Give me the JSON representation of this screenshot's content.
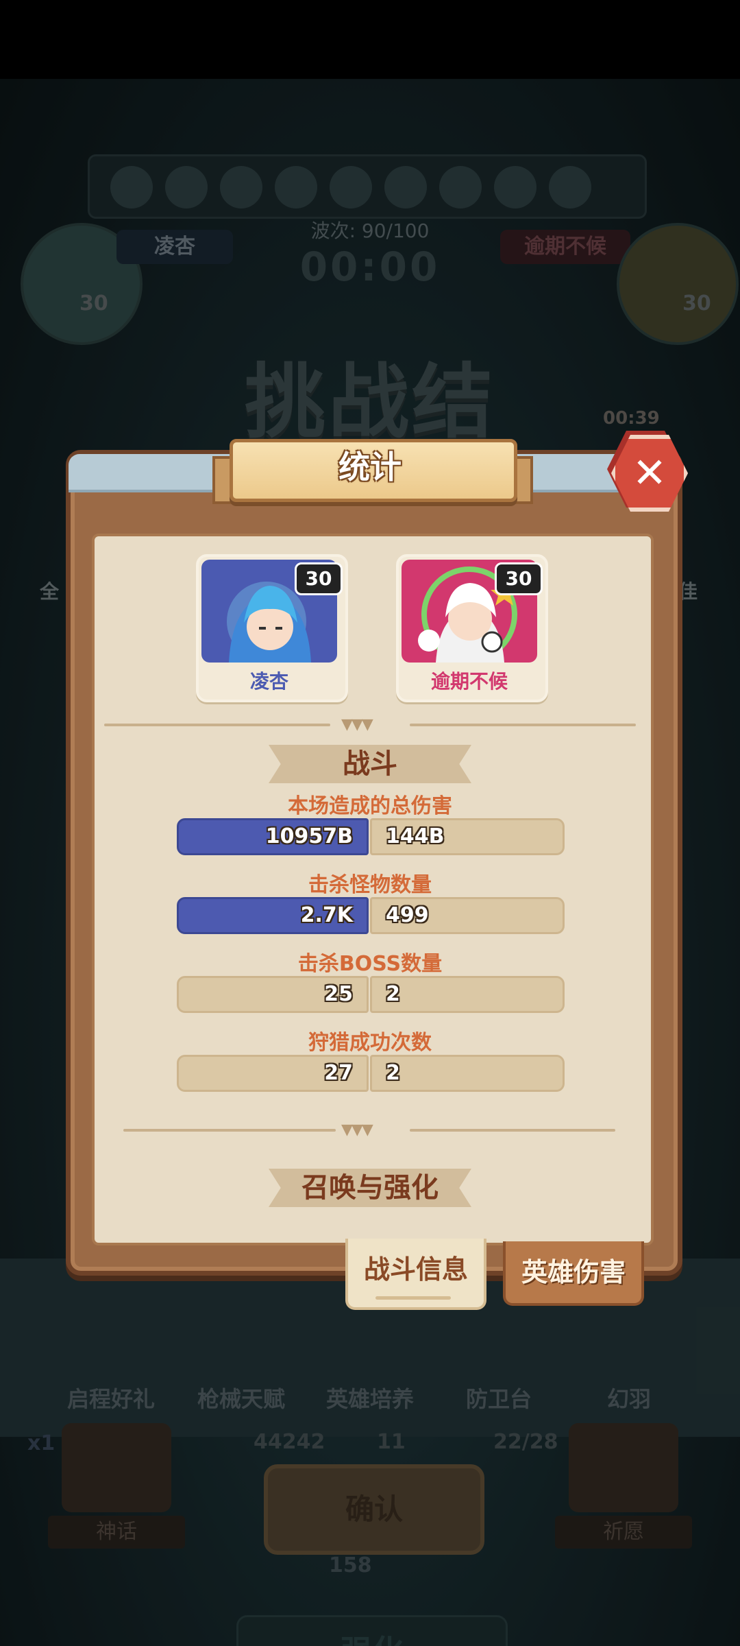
{
  "background": {
    "opponent_left_name": "凌杏",
    "opponent_left_level": "30",
    "opponent_right_name": "逾期不候",
    "opponent_right_level": "30",
    "wave_text": "波次: 90/100",
    "timer": "00:00",
    "big_title": "挑战结束",
    "countdown": "00:39",
    "side_left_text": "全",
    "side_right_text": "佳",
    "menu_items": [
      "启程好礼",
      "枪械天赋",
      "英雄培养",
      "防卫台",
      "幻羽"
    ],
    "stats": [
      "44242",
      "11",
      "22/28"
    ],
    "confirm_label": "确认",
    "coin_count": "158",
    "enhance_label": "强化",
    "corner_left_label": "神话",
    "corner_right_label": "祈愿",
    "speed_label": "x1"
  },
  "dialog": {
    "title": "统计",
    "heroes": [
      {
        "name": "凌杏",
        "level": "30",
        "color": "#4b5ab1"
      },
      {
        "name": "逾期不候",
        "level": "30",
        "color": "#d2386e"
      }
    ],
    "section_battle": "战斗",
    "section_summon": "召唤与强化",
    "stats": [
      {
        "label": "本场造成的总伤害",
        "left": "10957B",
        "right": "144B",
        "left_wins": true
      },
      {
        "label": "击杀怪物数量",
        "left": "2.7K",
        "right": "499",
        "left_wins": true
      },
      {
        "label": "击杀BOSS数量",
        "left": "25",
        "right": "2",
        "left_wins": false
      },
      {
        "label": "狩猎成功次数",
        "left": "27",
        "right": "2",
        "left_wins": false
      }
    ],
    "tabs": {
      "battle_info": "战斗信息",
      "hero_damage": "英雄伤害"
    }
  },
  "colors": {
    "win_bar": "#4d5ab0",
    "neutral_bar": "#dbc8a5",
    "stat_label": "#d46a38",
    "close_button": "#d44b3c"
  }
}
